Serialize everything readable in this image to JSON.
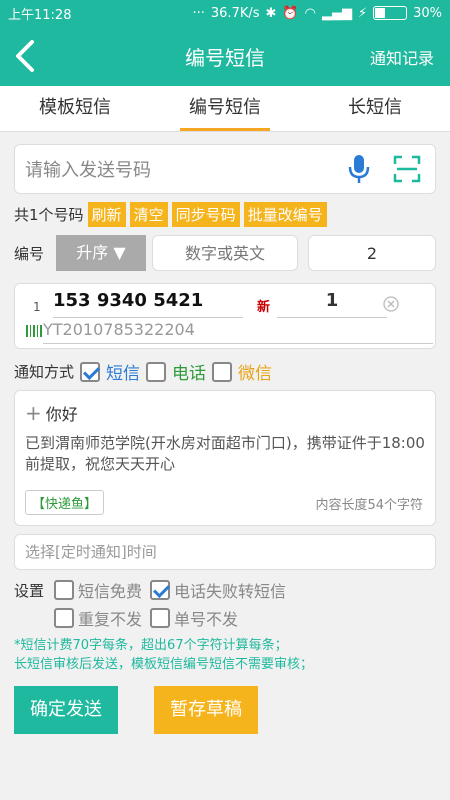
{
  "status": {
    "time": "上午11:28",
    "speed": "36.7K/s",
    "battery": "30%",
    "battery_level": 0.3
  },
  "header": {
    "title": "编号短信",
    "records": "通知记录"
  },
  "tabs": [
    {
      "label": "模板短信"
    },
    {
      "label": "编号短信"
    },
    {
      "label": "长短信"
    }
  ],
  "phone_input": {
    "placeholder": "请输入发送号码"
  },
  "count": {
    "label": "共1个号码",
    "buttons": [
      "刷新",
      "清空",
      "同步号码",
      "批量改编号"
    ]
  },
  "numbering": {
    "label": "编号",
    "sort": "升序 ▼",
    "placeholder": "数字或英文",
    "value": "2"
  },
  "entry": {
    "index": "1",
    "phone": "153 9340 5421",
    "tag": "新",
    "qty": "1",
    "tracking": "YT2010785322204"
  },
  "notify": {
    "label": "通知方式",
    "options": [
      {
        "label": "短信",
        "checked": true,
        "color": "#2a7bd5"
      },
      {
        "label": "电话",
        "checked": false,
        "color": "#2e9a3a"
      },
      {
        "label": "微信",
        "checked": false,
        "color": "#e8a317"
      }
    ]
  },
  "message": {
    "greeting": "你好",
    "body": "已到渭南师范学院(开水房对面超市门口)，携带证件于18:00前提取，祝您天天开心",
    "signature": "【快递鱼】",
    "length": "内容长度54个字符"
  },
  "schedule": {
    "placeholder": "选择[定时通知]时间"
  },
  "settings": {
    "label": "设置",
    "row1": [
      {
        "label": "短信免费",
        "checked": false
      },
      {
        "label": "电话失败转短信",
        "checked": true
      }
    ],
    "row2": [
      {
        "label": "重复不发",
        "checked": false
      },
      {
        "label": "单号不发",
        "checked": false
      }
    ]
  },
  "notes": {
    "line1": "*短信计费70字每条，超出67个字符计算每条；",
    "line2": "长短信审核后发送，模板短信编号短信不需要审核；"
  },
  "actions": {
    "send": "确定发送",
    "draft": "暂存草稿"
  }
}
